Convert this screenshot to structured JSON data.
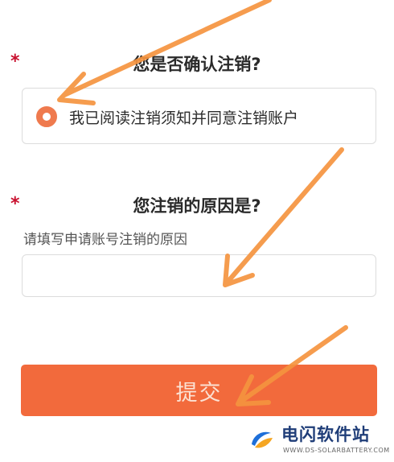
{
  "form": {
    "required_mark": "*",
    "confirm_question": "您是否确认注销?",
    "confirm_option_label": "我已阅读注销须知并同意注销账户",
    "confirm_option_selected": true,
    "reason_question": "您注销的原因是?",
    "reason_hint": "请填写申请账号注销的原因",
    "reason_value": "",
    "submit_label": "提交"
  },
  "watermark": {
    "title": "电闪软件站",
    "url": "WWW.DS-SOLARBATTERY.COM"
  },
  "colors": {
    "accent": "#f26a3c",
    "radio": "#ef7a4e",
    "required": "#c8102e",
    "annotation_arrow": "#f5943f",
    "watermark_text": "#1f3d78"
  }
}
